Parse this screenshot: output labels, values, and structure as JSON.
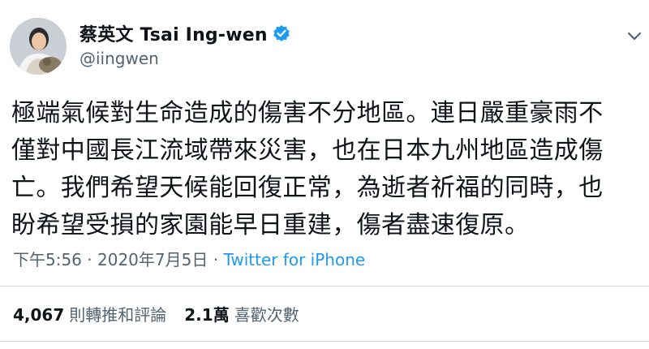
{
  "author": {
    "display_name": "蔡英文 Tsai Ing-wen",
    "handle": "@iingwen",
    "verified": true
  },
  "tweet": {
    "lines": [
      "極端氣候對生命造成的傷害不分地區。連日嚴重豪雨不",
      "僅對中國長江流域帶來災害，也在日本九州地區造成傷",
      "亡。我們希望天候能回復正常，為逝者祈福的同時，也",
      "盼希望受損的家園能早日重建，傷者盡速復原。"
    ]
  },
  "meta": {
    "time": "下午5:56",
    "separator": "·",
    "date": "2020年7月5日",
    "source": "Twitter for iPhone"
  },
  "stats": {
    "retweets_count": "4,067",
    "retweets_label": "則轉推和評論",
    "likes_count": "2.1萬",
    "likes_label": "喜歡次數"
  },
  "colors": {
    "link": "#1d9bf0",
    "verified": "#1d9bf0",
    "secondary_text": "#536471",
    "divider": "#cfd9de"
  },
  "icons": {
    "verified": "verified-badge-icon",
    "more": "more-options-icon"
  }
}
